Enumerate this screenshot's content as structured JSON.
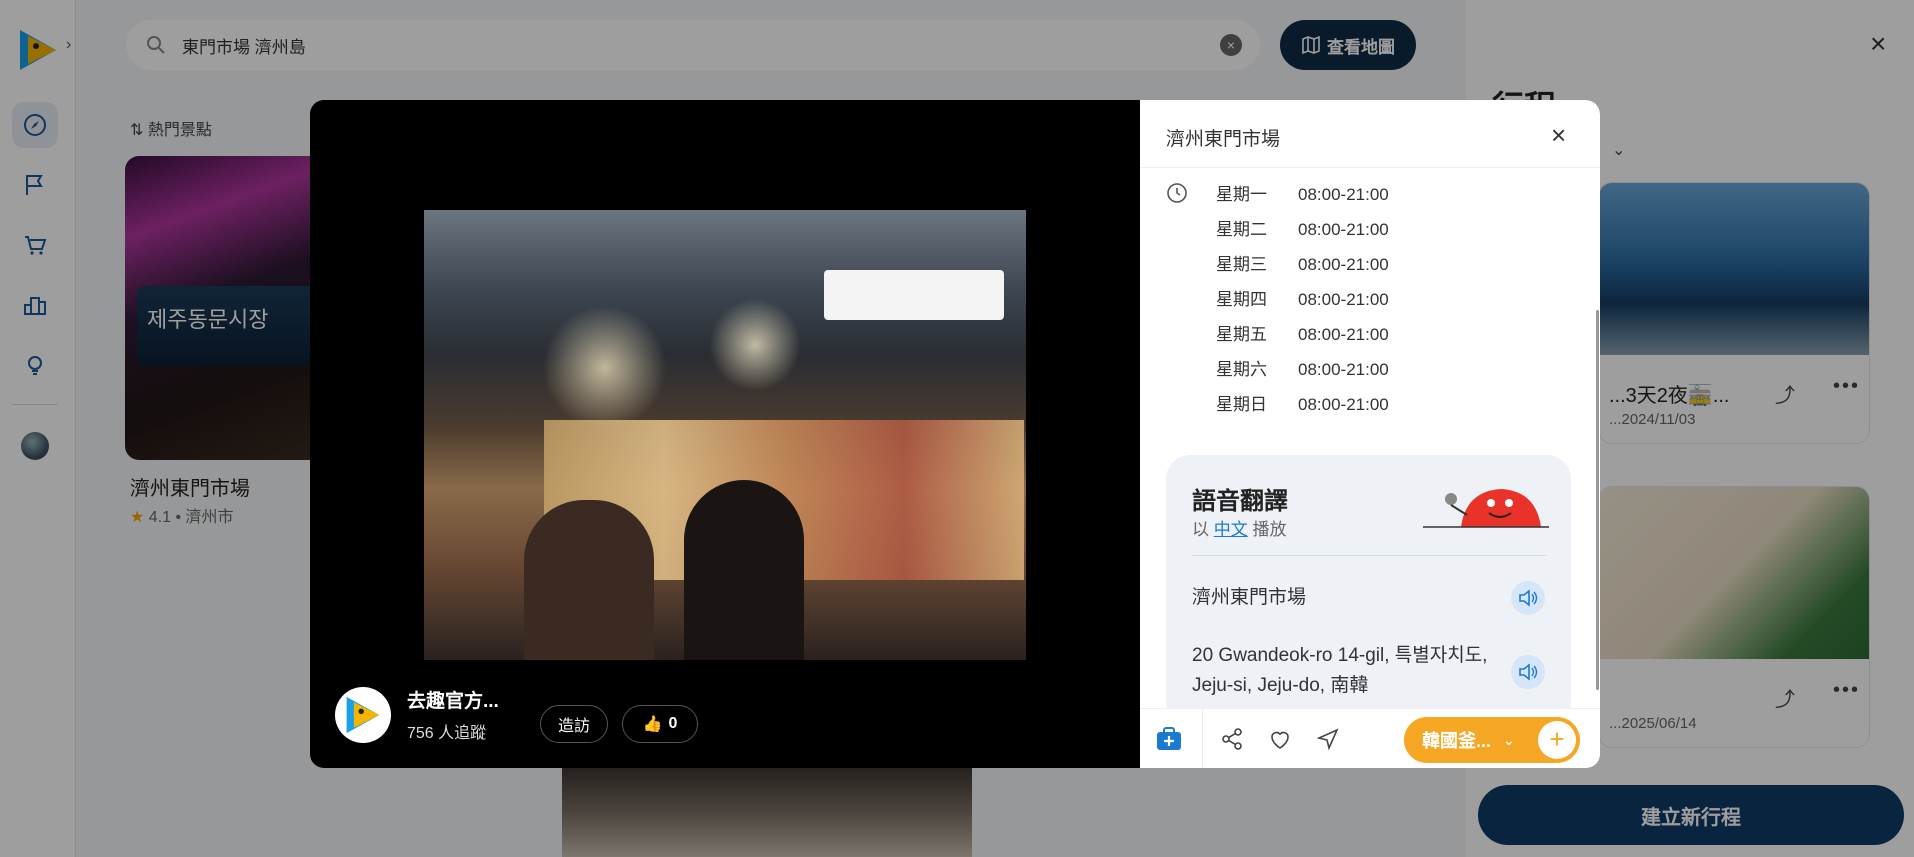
{
  "search": {
    "query": "東門市場 濟州島"
  },
  "map_button": {
    "label": "查看地圖"
  },
  "sort": {
    "label": "熱門景點"
  },
  "results": [
    {
      "name": "濟州東門市場",
      "rating": "4.1",
      "city": "濟州市",
      "sign_text": "제주동문시장"
    }
  ],
  "right_panel": {
    "title": "行程",
    "new_trip_label": "建立新行程",
    "trips": [
      {
        "name": "...3天2夜🚋...",
        "date": "...2024/11/03"
      },
      {
        "name": "",
        "date": "...2025/06/14"
      }
    ]
  },
  "modal": {
    "place_title": "濟州東門市場",
    "poster": {
      "name": "去趣官方...",
      "followers": "756 人追蹤"
    },
    "visit_label": "造訪",
    "likes": "0",
    "hours": [
      {
        "day": "星期一",
        "time": "08:00-21:00"
      },
      {
        "day": "星期二",
        "time": "08:00-21:00"
      },
      {
        "day": "星期三",
        "time": "08:00-21:00"
      },
      {
        "day": "星期四",
        "time": "08:00-21:00"
      },
      {
        "day": "星期五",
        "time": "08:00-21:00"
      },
      {
        "day": "星期六",
        "time": "08:00-21:00"
      },
      {
        "day": "星期日",
        "time": "08:00-21:00"
      }
    ],
    "voice": {
      "title": "語音翻譯",
      "prefix": "以",
      "language": "中文",
      "suffix": "播放",
      "items": [
        "濟州東門市場",
        "20 Gwandeok-ro 14-gil, 특별자치도, Jeju-si, Jeju-do, 南韓"
      ]
    },
    "trip_select": "韓國釜..."
  },
  "colors": {
    "accent_orange": "#f5a623",
    "navy": "#0f2a44",
    "link_blue": "#1a7ad0"
  }
}
